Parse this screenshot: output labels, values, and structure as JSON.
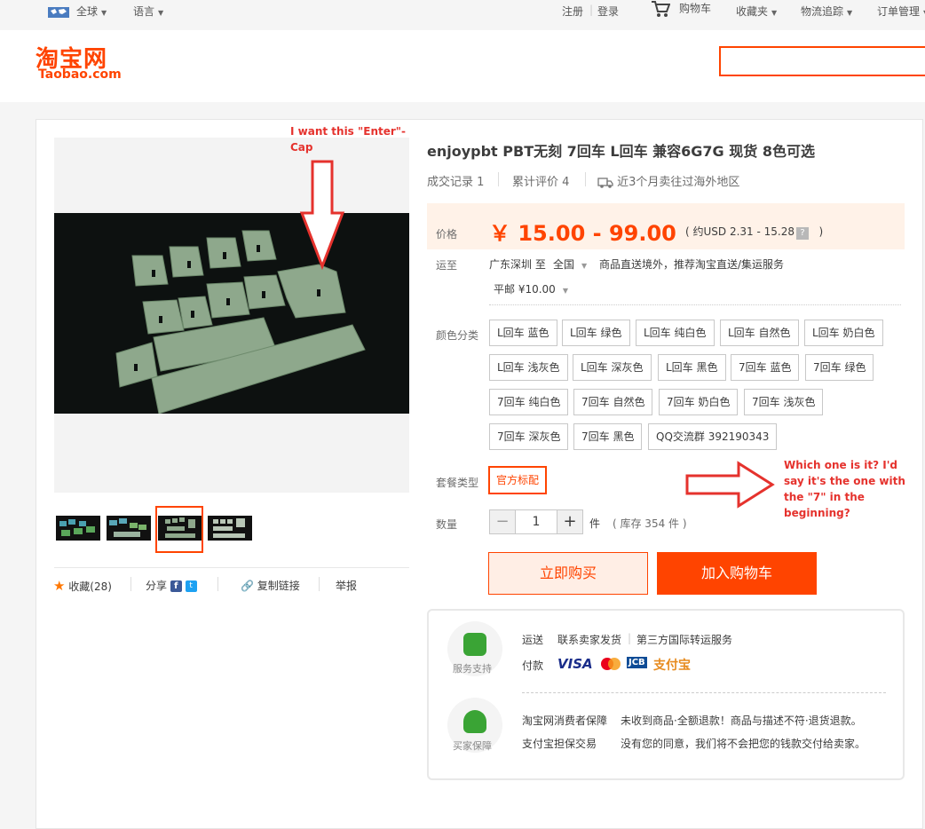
{
  "topbar": {
    "region": "全球",
    "language": "语言",
    "register": "注册",
    "login": "登录",
    "cart": "购物车",
    "favorites": "收藏夹",
    "logistics": "物流追踪",
    "orders": "订单管理"
  },
  "header": {
    "logo_cn": "淘宝网",
    "logo_en": "Taobao.com",
    "search_placeholder": ""
  },
  "product": {
    "title": "enjoypbt PBT无刻 7回车 L回车 兼容6G7G 现货 8色可选",
    "sales_label": "成交记录",
    "sales_count": "1",
    "reviews_label": "累计评价",
    "reviews_count": "4",
    "overseas_note": "近3个月卖往过海外地区",
    "price_label": "价格",
    "price": "￥ 15.00 - 99.00",
    "price_usd_prefix": "( 约USD 2.31 - 15.28",
    "price_usd_help": "?",
    "price_usd_suffix": ")",
    "ship_label": "运至",
    "ship_from": "广东深圳 至",
    "ship_to": "全国",
    "ship_note": "商品直送境外，推荐淘宝直送/集运服务",
    "shipping_fee": "平邮 ¥10.00",
    "color_label": "颜色分类",
    "colors": [
      "L回车 蓝色",
      "L回车 绿色",
      "L回车 纯白色",
      "L回车 自然色",
      "L回车 奶白色",
      "L回车 浅灰色",
      "L回车 深灰色",
      "L回车 黑色",
      "7回车 蓝色",
      "7回车 绿色",
      "7回车 纯白色",
      "7回车 自然色",
      "7回车 奶白色",
      "7回车 浅灰色",
      "7回车 深灰色",
      "7回车 黑色",
      "QQ交流群 392190343"
    ],
    "package_label": "套餐类型",
    "package_value": "官方标配",
    "qty_label": "数量",
    "qty_minus": "−",
    "qty_value": "1",
    "qty_plus": "+",
    "qty_unit": "件",
    "stock": "( 库存 354 件 )",
    "buy_now": "立即购买",
    "add_to_cart": "加入购物车"
  },
  "gallery": {
    "fav_label": "收藏(28)",
    "share_label": "分享",
    "copy_link": "复制链接",
    "report": "举报"
  },
  "service": {
    "support_title": "服务支持",
    "ship_label": "运送",
    "ship_value1": "联系卖家发货",
    "ship_value2": "第三方国际转运服务",
    "pay_label": "付款",
    "card_visa": "VISA",
    "card_jcb": "JCB",
    "card_alipay": "支付宝",
    "guarantee_title": "买家保障",
    "guarantee1_label": "淘宝网消费者保障",
    "guarantee1_text": "未收到商品·全额退款！商品与描述不符·退货退款。",
    "guarantee2_label": "支付宝担保交易",
    "guarantee2_text": "没有您的同意，我们将不会把您的钱款交付给卖家。"
  },
  "annotations": {
    "top_note": "I want this \"Enter\"-Cap",
    "right_note": "Which one is it? I'd say it's the one with the \"7\" in the beginning?"
  },
  "colors": {
    "accent": "#ff4400",
    "annotation": "#e5322d",
    "price_bg": "#fff2e8"
  }
}
